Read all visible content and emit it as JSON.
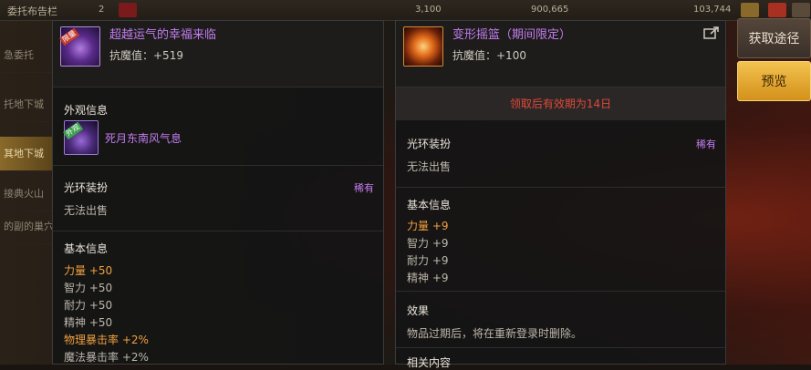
{
  "topbar": {
    "title": "委托布告栏",
    "count": "2",
    "gold1": "3,100",
    "gold2": "900,665",
    "gold3": "103,744"
  },
  "leftnav": [
    "急委托",
    "托地下城",
    "其地下城",
    "接典火山",
    "的副的巢穴"
  ],
  "panel1": {
    "item_name": "超越运气的幸福来临",
    "resistance": "抗魔值：+519",
    "badge": "限量",
    "appearance_title": "外观信息",
    "appearance_item": "死月东南风气息",
    "appearance_badge": "外观",
    "aura_title": "光环装扮",
    "aura_rarity": "稀有",
    "no_sale": "无法出售",
    "basic_title": "基本信息",
    "stats": [
      {
        "text": "力量 +50",
        "hl": true
      },
      {
        "text": "智力 +50",
        "hl": false
      },
      {
        "text": "耐力 +50",
        "hl": false
      },
      {
        "text": "精神 +50",
        "hl": false
      },
      {
        "text": "物理暴击率 +2%",
        "hl": true
      },
      {
        "text": "魔法暴击率 +2%",
        "hl": false
      }
    ]
  },
  "panel2": {
    "item_name": "变形摇篮（期间限定）",
    "resistance": "抗魔值：+100",
    "notice": "领取后有效期为14日",
    "aura_title": "光环装扮",
    "aura_rarity": "稀有",
    "no_sale": "无法出售",
    "basic_title": "基本信息",
    "stats": [
      {
        "text": "力量 +9",
        "hl": true
      },
      {
        "text": "智力 +9",
        "hl": false
      },
      {
        "text": "耐力 +9",
        "hl": false
      },
      {
        "text": "精神 +9",
        "hl": false
      }
    ],
    "effect_title": "效果",
    "effect_text": "物品过期后，将在重新登录时删除。",
    "related_title": "相关内容"
  },
  "buttons": {
    "get_path": "获取途径",
    "preview": "预览"
  },
  "colors": {
    "rare_purple": "#c37df0",
    "highlight_orange": "#f0a040",
    "notice_red": "#e04a3a"
  }
}
